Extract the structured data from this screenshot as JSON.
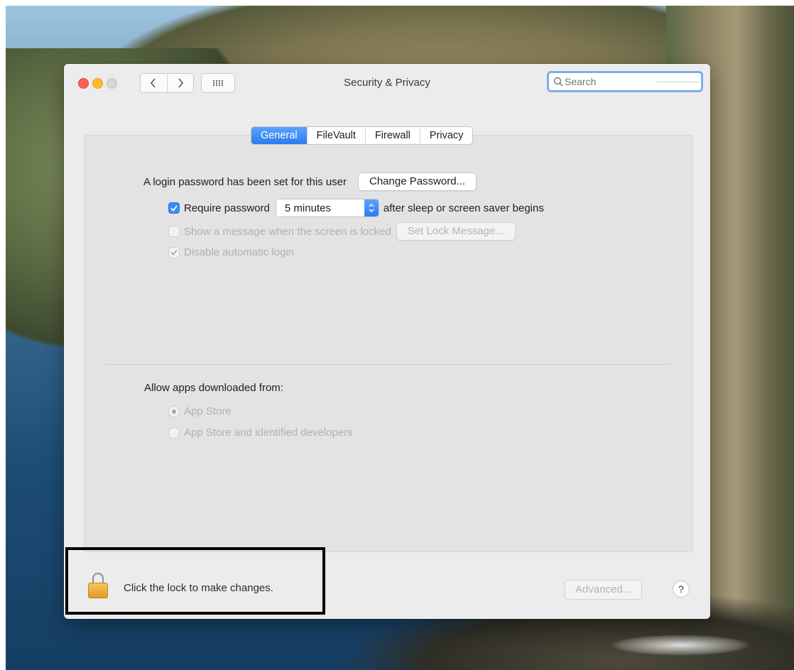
{
  "window": {
    "title": "Security & Privacy"
  },
  "toolbar": {
    "back_icon": "chevron-left-icon",
    "forward_icon": "chevron-right-icon",
    "grid_icon": "grid-icon",
    "search_placeholder": "Search"
  },
  "tabs": [
    {
      "label": "General",
      "active": true
    },
    {
      "label": "FileVault",
      "active": false
    },
    {
      "label": "Firewall",
      "active": false
    },
    {
      "label": "Privacy",
      "active": false
    }
  ],
  "general": {
    "login_password_text": "A login password has been set for this user",
    "change_password_label": "Change Password...",
    "require_password": {
      "label": "Require password",
      "checked": true,
      "interval": "5 minutes",
      "suffix": "after sleep or screen saver begins"
    },
    "show_message": {
      "label": "Show a message when the screen is locked",
      "checked": false,
      "enabled": false,
      "button_label": "Set Lock Message..."
    },
    "disable_auto_login": {
      "label": "Disable automatic login",
      "checked": true,
      "enabled": false
    }
  },
  "allow_apps": {
    "heading": "Allow apps downloaded from:",
    "options": [
      {
        "label": "App Store",
        "selected": true
      },
      {
        "label": "App Store and identified developers",
        "selected": false
      }
    ]
  },
  "footer": {
    "lock_text": "Click the lock to make changes.",
    "advanced_label": "Advanced...",
    "help_label": "?"
  },
  "colors": {
    "accent": "#2a7cf3",
    "close": "#fd5f57",
    "minimize": "#febc2e",
    "lock": "#e39a23"
  }
}
